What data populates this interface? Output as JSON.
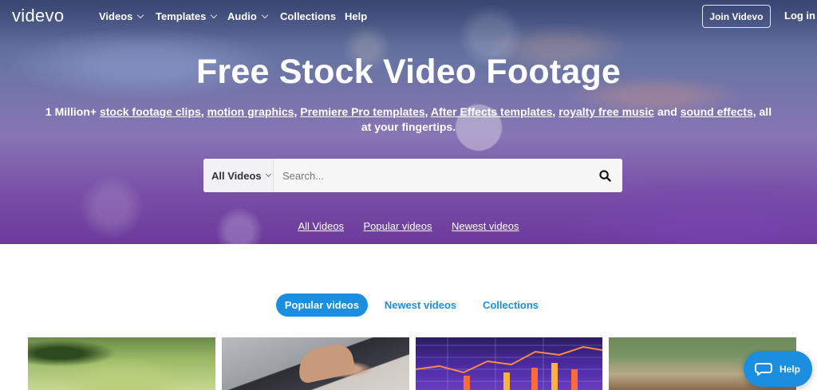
{
  "nav": {
    "logo": "videvo",
    "items": [
      {
        "label": "Videos",
        "dropdown": true
      },
      {
        "label": "Templates",
        "dropdown": true
      },
      {
        "label": "Audio",
        "dropdown": true
      },
      {
        "label": "Collections",
        "dropdown": false
      },
      {
        "label": "Help",
        "dropdown": false
      }
    ],
    "join_label": "Join Videvo",
    "login_label": "Log in"
  },
  "hero": {
    "title": "Free Stock Video Footage",
    "subtitle": {
      "prefix": "1 Million+",
      "link1": "stock footage clips",
      "sep1": ",",
      "link2": "motion graphics",
      "sep2": ",",
      "link3": "Premiere Pro templates",
      "sep3": ",",
      "link4": "After Effects templates",
      "sep4": ",",
      "link5": "royalty free music",
      "sep5": "and",
      "link6": "sound effects",
      "suffix": ", all at your fingertips."
    },
    "search": {
      "category": "All Videos",
      "placeholder": "Search..."
    },
    "quick_links": [
      "All Videos",
      "Popular videos",
      "Newest videos"
    ]
  },
  "tabs": [
    {
      "label": "Popular videos",
      "active": true
    },
    {
      "label": "Newest videos",
      "active": false
    },
    {
      "label": "Collections",
      "active": false
    }
  ],
  "help_label": "Help",
  "colors": {
    "accent": "#1c8ee0",
    "hero_purple": "#7a4ea8"
  }
}
